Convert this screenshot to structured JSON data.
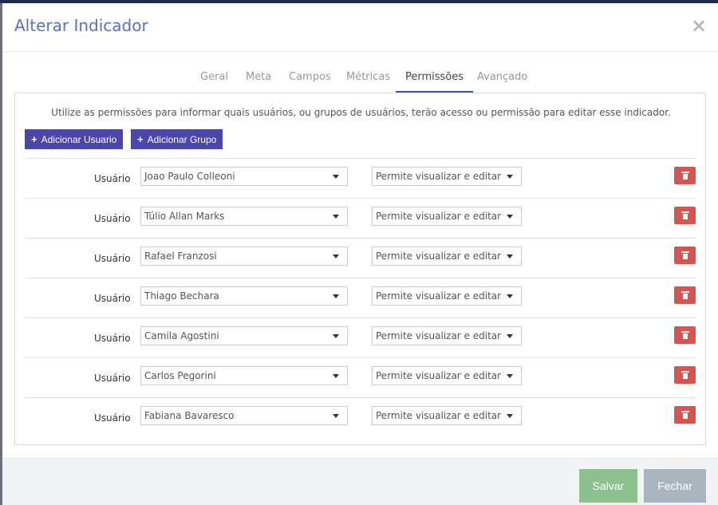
{
  "modal": {
    "title": "Alterar Indicador",
    "close_icon": "×"
  },
  "tabs": [
    {
      "label": "Geral"
    },
    {
      "label": "Meta"
    },
    {
      "label": "Campos"
    },
    {
      "label": "Métricas"
    },
    {
      "label": "Permissões",
      "active": true
    },
    {
      "label": "Avançado"
    }
  ],
  "panel": {
    "info_text": "Utilize as permissões para informar quais usuários, ou grupos de usuários, terão acesso ou permissão para editar esse indicador.",
    "add_user_label": "Adicionar Usuario",
    "add_group_label": "Adicionar Grupo",
    "plus_icon": "+"
  },
  "permissions": [
    {
      "type_label": "Usuário",
      "user": "Joao Paulo Colleoni",
      "permission": "Permite visualizar e editar"
    },
    {
      "type_label": "Usuário",
      "user": "Túlio Allan Marks",
      "permission": "Permite visualizar e editar"
    },
    {
      "type_label": "Usuário",
      "user": "Rafael Franzosi",
      "permission": "Permite visualizar e editar"
    },
    {
      "type_label": "Usuário",
      "user": "Thiago Bechara",
      "permission": "Permite visualizar e editar"
    },
    {
      "type_label": "Usuário",
      "user": "Camila Agostini",
      "permission": "Permite visualizar e editar"
    },
    {
      "type_label": "Usuário",
      "user": "Carlos Pegorini",
      "permission": "Permite visualizar e editar"
    },
    {
      "type_label": "Usuário",
      "user": "Fabiana Bavaresco",
      "permission": "Permite visualizar e editar"
    }
  ],
  "footer": {
    "save_label": "Salvar",
    "close_label": "Fechar"
  },
  "colors": {
    "title": "#5b6fc4",
    "primary_button": "#4a47a8",
    "delete_button": "#d9534f",
    "save_button": "#8cc08e",
    "close_button": "#a9b4be"
  }
}
